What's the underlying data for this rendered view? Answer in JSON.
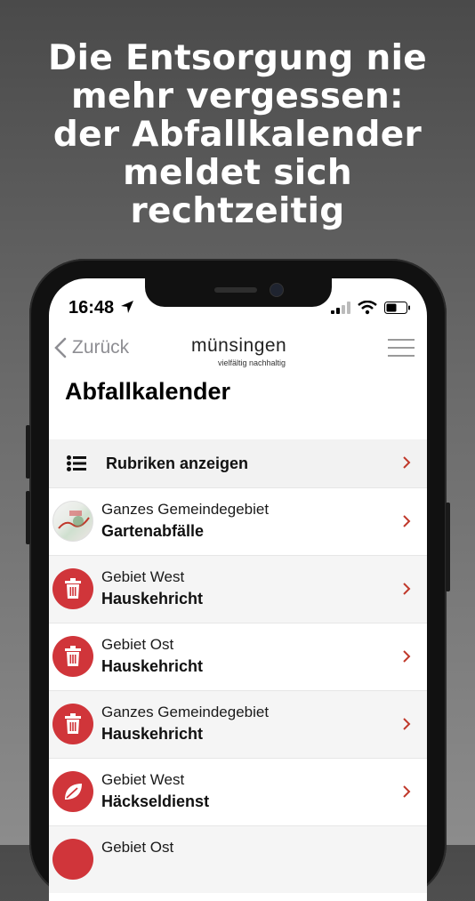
{
  "headline": {
    "lines": [
      "Die Entsorgung nie",
      "mehr vergessen:",
      "der Abfallkalender",
      "meldet sich",
      "rechtzeitig"
    ]
  },
  "status_bar": {
    "time": "16:48"
  },
  "nav": {
    "back_label": "Zurück",
    "logo_text": "münsingen",
    "logo_tagline": "vielfältig nachhaltig"
  },
  "page": {
    "title": "Abfallkalender"
  },
  "rubriken": {
    "label": "Rubriken anzeigen"
  },
  "entries": [
    {
      "area": "Ganzes Gemeindegebiet",
      "type": "Gartenabfälle",
      "icon": "map-thumbnail"
    },
    {
      "area": "Gebiet West",
      "type": "Hauskehricht",
      "icon": "trash-icon"
    },
    {
      "area": "Gebiet Ost",
      "type": "Hauskehricht",
      "icon": "trash-icon"
    },
    {
      "area": "Ganzes Gemeindegebiet",
      "type": "Hauskehricht",
      "icon": "trash-icon"
    },
    {
      "area": "Gebiet West",
      "type": "Häckseldienst",
      "icon": "leaf-icon"
    },
    {
      "area": "Gebiet Ost",
      "type": "",
      "icon": "trash-icon"
    }
  ],
  "colors": {
    "accent": "#d0353a",
    "chevron": "#c0392b",
    "background_top": "#4a4a4a",
    "background_bottom": "#8c8c8c"
  }
}
